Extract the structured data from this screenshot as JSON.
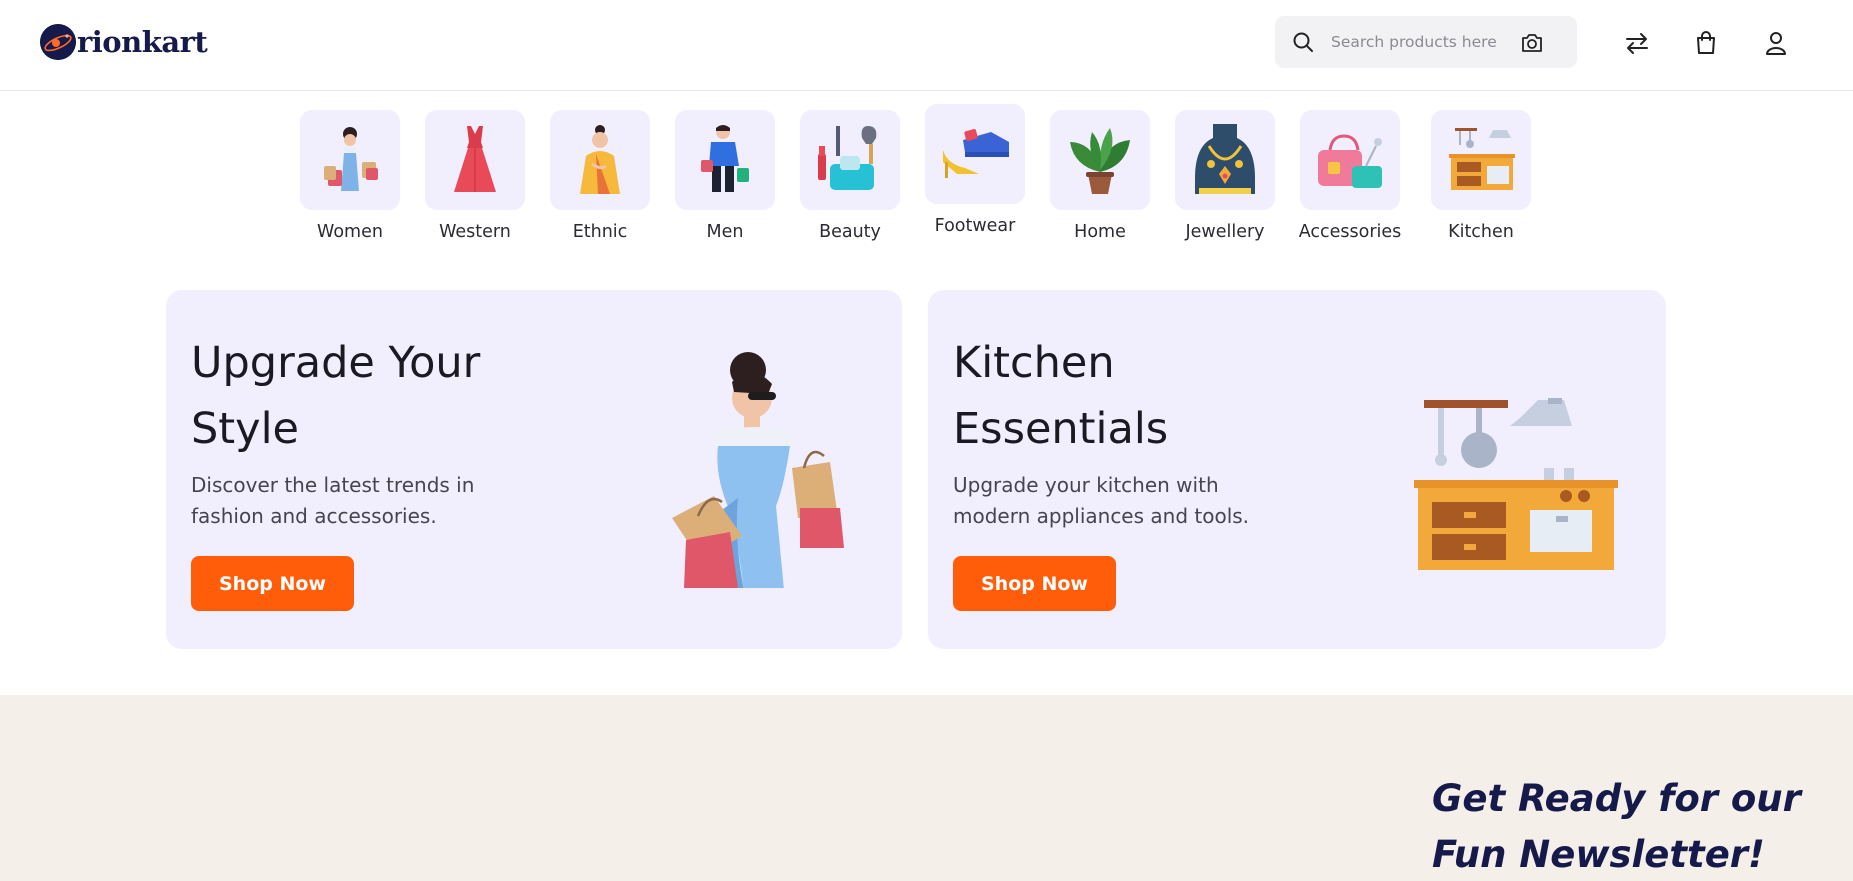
{
  "brand": {
    "name": "rionkart",
    "accent": "#151a4a"
  },
  "search": {
    "placeholder": "Search products here",
    "value": ""
  },
  "header_icons": [
    "swap-icon",
    "cart-icon",
    "user-icon"
  ],
  "categories": [
    {
      "label": "Women"
    },
    {
      "label": "Western"
    },
    {
      "label": "Ethnic"
    },
    {
      "label": "Men"
    },
    {
      "label": "Beauty"
    },
    {
      "label": "Footwear"
    },
    {
      "label": "Home"
    },
    {
      "label": "Jewellery"
    },
    {
      "label": "Accessories"
    },
    {
      "label": "Kitchen"
    }
  ],
  "promos": [
    {
      "title": "Upgrade Your Style",
      "description": "Discover the latest trends in fashion and accessories.",
      "button": "Shop Now"
    },
    {
      "title": "Kitchen Essentials",
      "description": "Upgrade your kitchen with modern appliances and tools.",
      "button": "Shop Now"
    }
  ],
  "newsletter": {
    "title": "Get Ready for our Fun Newsletter!"
  },
  "colors": {
    "tile_bg": "#f1eefe",
    "button": "#ff5d0a",
    "newsletter_bg": "#f5efe9"
  }
}
